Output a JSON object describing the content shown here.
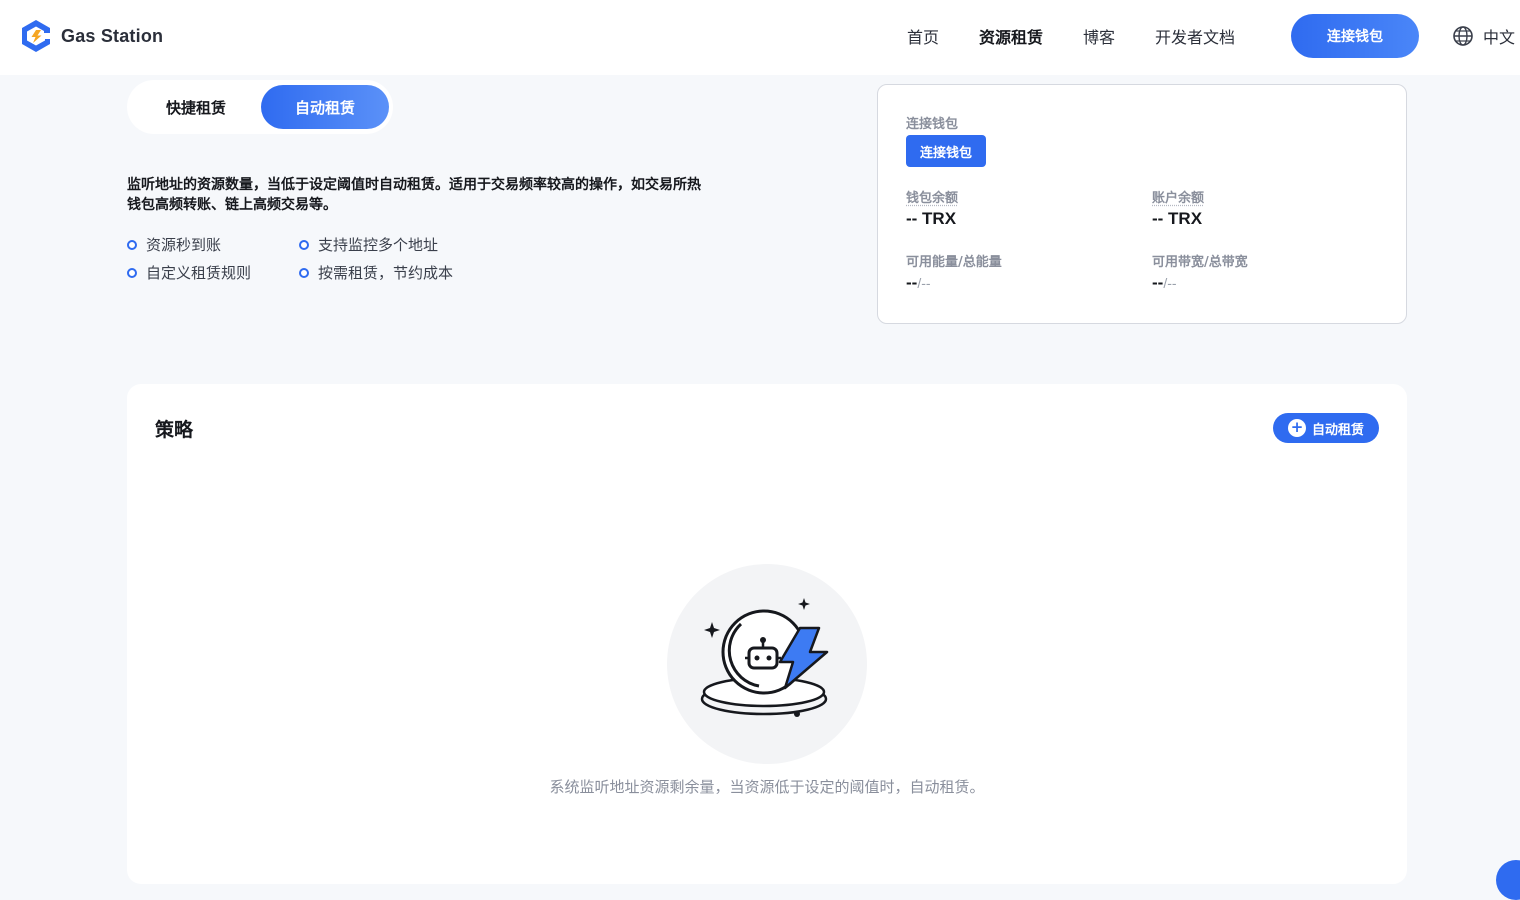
{
  "header": {
    "brand": "Gas Station",
    "nav": [
      {
        "label": "首页",
        "active": false
      },
      {
        "label": "资源租赁",
        "active": true
      },
      {
        "label": "博客",
        "active": false
      },
      {
        "label": "开发者文档",
        "active": false
      }
    ],
    "connect_label": "连接钱包",
    "language": "中文"
  },
  "mode_tabs": {
    "quick": "快捷租赁",
    "auto": "自动租赁",
    "selected": "auto"
  },
  "description": {
    "line1": "监听地址的资源数量，当低于设定阈值时自动租赁。适用于交易频率较高的操作，如交易所热",
    "line2": "钱包高频转账、链上高频交易等。"
  },
  "features": [
    "资源秒到账",
    "支持监控多个地址",
    "自定义租赁规则",
    "按需租赁，节约成本"
  ],
  "wallet": {
    "connect_title": "连接钱包",
    "connect_button": "连接钱包",
    "wallet_balance_label": "钱包余额",
    "wallet_balance_value": "-- TRX",
    "account_balance_label": "账户余额",
    "account_balance_value": "-- TRX",
    "energy_label": "可用能量/总能量",
    "energy_available": "--",
    "energy_total": "/--",
    "bandwidth_label": "可用带宽/总带宽",
    "bandwidth_available": "--",
    "bandwidth_total": "/--"
  },
  "strategy": {
    "title": "策略",
    "add_button": "自动租赁",
    "empty_text": "系统监听地址资源剩余量，当资源低于设定的阈值时，自动租赁。"
  },
  "colors": {
    "primary": "#2f6bf0",
    "background": "#f6f8fb",
    "card": "#ffffff"
  },
  "icons": [
    "gas-station-logo-icon",
    "globe-icon",
    "plus-circle-icon",
    "robot-lightning-icon"
  ]
}
